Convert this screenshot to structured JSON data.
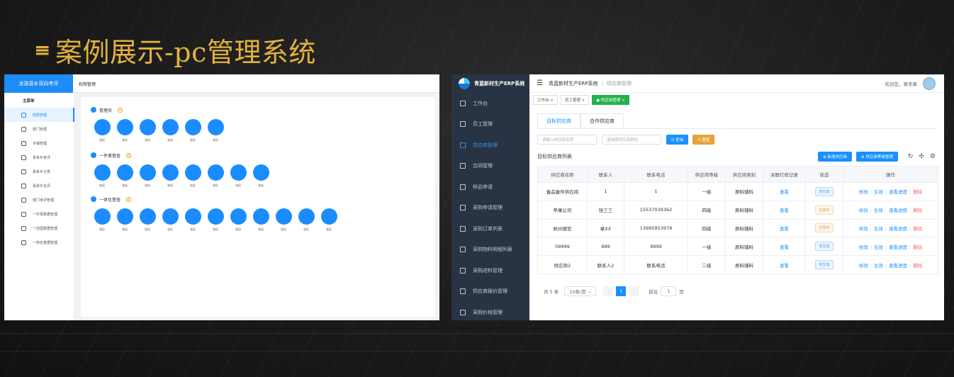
{
  "title": "案例展示-pc管理系统",
  "left": {
    "brand": "龙游县乡双向考评",
    "breadcrumb": "权限管理",
    "menu_title": "主菜单",
    "menu": [
      "权限管理",
      "部门管理",
      "乡镇管理",
      "县考乡考评",
      "县考乡分类",
      "县考乡总评",
      "部门考评管理",
      "一件事数据管理",
      "一坊团数据管理",
      "一体化数据管理"
    ],
    "groups": [
      {
        "name": "管理员",
        "count": 6
      },
      {
        "name": "一件事督查",
        "count": 8
      },
      {
        "name": "一体化督查",
        "count": 11
      }
    ],
    "member_name": "张佳"
  },
  "right": {
    "brand": "青蓝新材生产ERP系统",
    "menu": [
      "工作台",
      "员工管理",
      "供应商管理",
      "合同管理",
      "样品申请",
      "采购申请管理",
      "采购订单列表",
      "采购物料明细列表",
      "采购进料管理",
      "供应商报价管理",
      "采购价格管理"
    ],
    "breadcrumb": {
      "root": "青蓝新材生产ERP系统",
      "sep": "/",
      "current": "供应商管理"
    },
    "welcome": "欢迎您，黄孝果",
    "tags": [
      "工作台 ×",
      "员工管理 ×",
      "● 供应商管理 ×"
    ],
    "tabs": [
      "目标供应商",
      "合作供应商"
    ],
    "filter": {
      "name_placeholder": "请输入供应商名称",
      "type_placeholder": "请选择供应商类别",
      "query": "Q 查询",
      "reset": "⟲ 重置"
    },
    "list_title": "目标供应商列表",
    "btn_add": "⊕ 新增供应商",
    "btn_level": "⊕ 供应商等级管理",
    "columns": [
      "供应商名称",
      "联系人",
      "联系电话",
      "供应商等级",
      "供应商类别",
      "关联打样记录",
      "状态",
      "操作"
    ],
    "rows": [
      {
        "name": "备品备件供应商",
        "contact": "1",
        "phone": "1",
        "level": "一级",
        "type": "原料辅料",
        "record": "查看",
        "status": "未生效",
        "status_color": "blue"
      },
      {
        "name": "苹果公司",
        "contact": "张三三",
        "phone": "15537039362",
        "level": "四级",
        "type": "原料辅料",
        "record": "查看",
        "status": "生效中",
        "status_color": "orange"
      },
      {
        "name": "杭州挪亚",
        "contact": "章XX",
        "phone": "13995953979",
        "level": "四级",
        "type": "原料辅料",
        "record": "查看",
        "status": "生效中",
        "status_color": "orange"
      },
      {
        "name": "09999",
        "contact": "999",
        "phone": "9999",
        "level": "一级",
        "type": "原料辅料",
        "record": "查看",
        "status": "未生效",
        "status_color": "blue"
      },
      {
        "name": "供应商2",
        "contact": "联系人2",
        "phone": "联系电话",
        "level": "二级",
        "type": "原料辅料",
        "record": "查看",
        "status": "未生效",
        "status_color": "blue"
      }
    ],
    "ops": {
      "edit": "修改",
      "enable": "生效",
      "progress": "查看进度",
      "delete": "删除",
      "sep": "|"
    },
    "pager": {
      "total": "共 5 条",
      "size": "10条/页",
      "page": "1",
      "goto": "前往",
      "unit": "页"
    }
  }
}
